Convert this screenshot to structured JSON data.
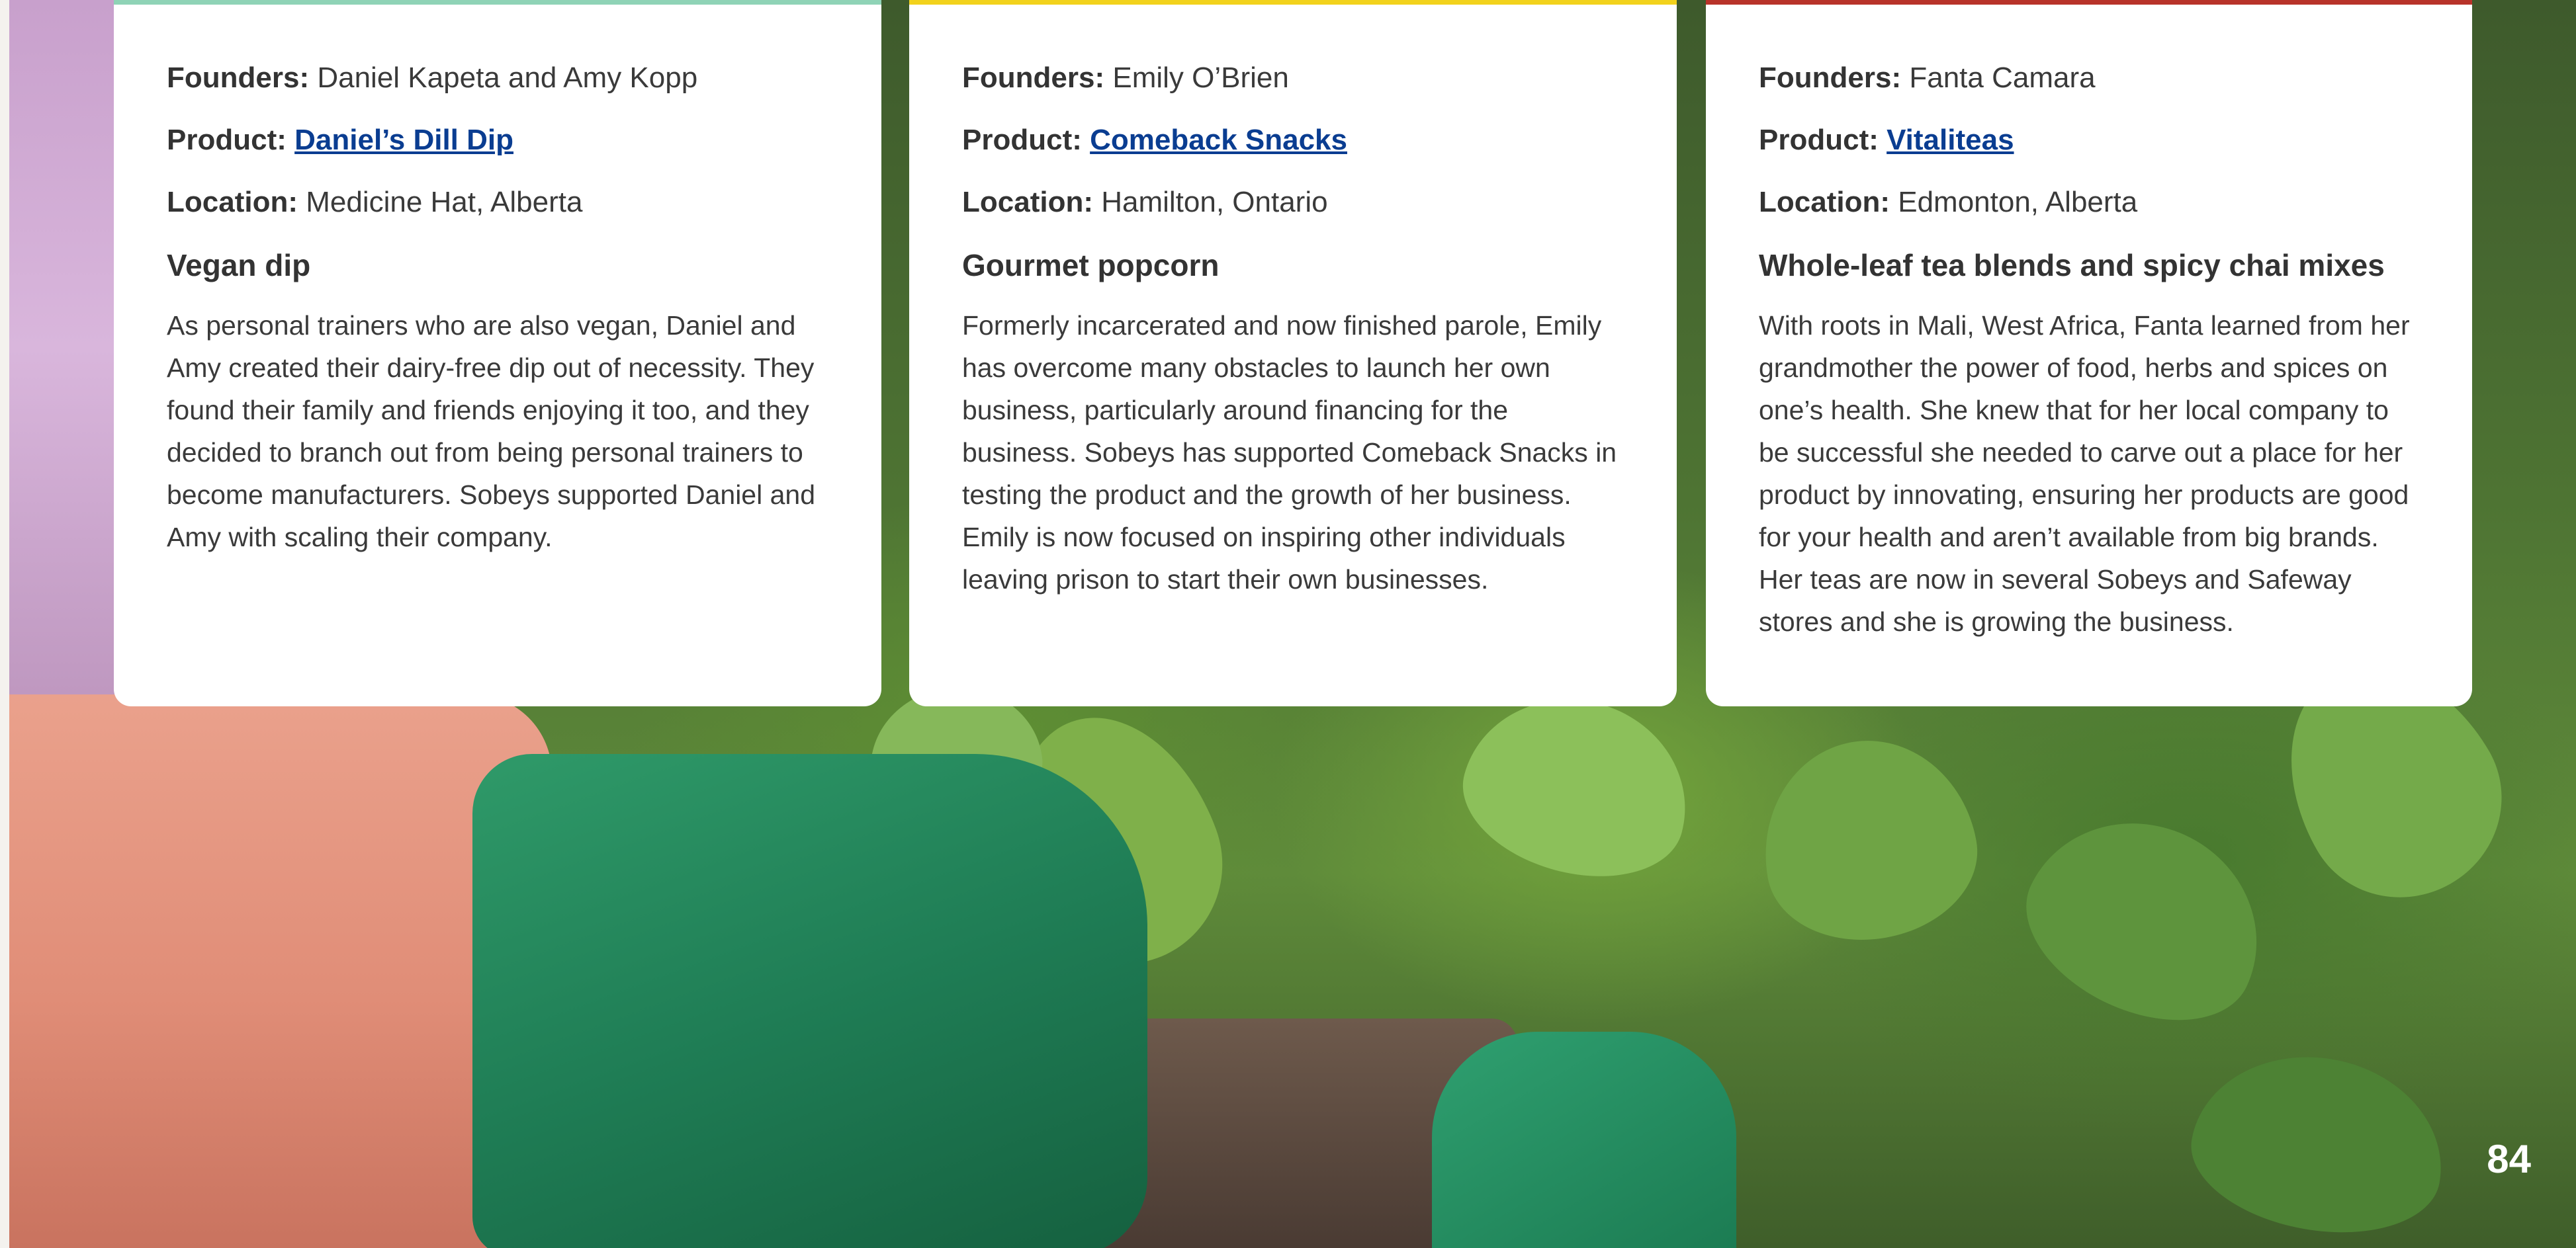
{
  "cards": [
    {
      "accent": "#8fd3b6",
      "founders_label": "Founders:",
      "founders": "Daniel Kapeta and Amy Kopp",
      "product_label": "Product:",
      "product": "Daniel’s Dill Dip",
      "location_label": "Location:",
      "location": "Medicine Hat, Alberta",
      "heading": "Vegan dip",
      "body": "As personal trainers who are also vegan, Daniel and Amy created their dairy-free dip out of necessity. They found their family and friends enjoying it too, and they decided to branch out from being personal trainers to become manufacturers. Sobeys supported Daniel and Amy with scaling their company."
    },
    {
      "accent": "#f2d21c",
      "founders_label": "Founders:",
      "founders": "Emily O’Brien",
      "product_label": "Product:",
      "product": "Comeback Snacks",
      "location_label": "Location:",
      "location": "Hamilton, Ontario",
      "heading": "Gourmet popcorn",
      "body": "Formerly incarcerated and now finished parole, Emily has overcome many obstacles to launch her own business, particularly around financing for the business. Sobeys has supported Comeback Snacks in testing the product and the growth of her business. Emily is now focused on inspiring other individuals leaving prison to start their own businesses."
    },
    {
      "accent": "#b8332a",
      "founders_label": "Founders:",
      "founders": "Fanta Camara",
      "product_label": "Product:",
      "product": "Vitaliteas",
      "location_label": "Location:",
      "location": "Edmonton, Alberta",
      "heading": "Whole-leaf tea blends and spicy chai mixes",
      "body": "With roots in Mali, West Africa, Fanta learned from her grandmother the power of food, herbs and spices on one’s health. She knew that for her local company to be successful she needed to carve out a place for her product by innovating, ensuring her products are good for your health and aren’t available from big brands. Her teas are now in several Sobeys and Safeway stores and she is growing the business."
    }
  ],
  "page_number": "84"
}
